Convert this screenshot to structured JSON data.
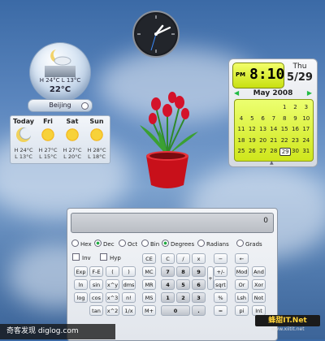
{
  "clock": {
    "time_shown": "1:23"
  },
  "weather": {
    "globe_line1": "H 24°C L 13°C",
    "globe_temp": "22°C",
    "city": "Beijing",
    "forecast": [
      {
        "day": "Today",
        "icon": "moon-cloud-icon",
        "high": "H 24°C",
        "low": "L 13°C"
      },
      {
        "day": "Fri",
        "icon": "sun-icon",
        "high": "H 27°C",
        "low": "L 15°C"
      },
      {
        "day": "Sat",
        "icon": "sun-icon",
        "high": "H 27°C",
        "low": "L 20°C"
      },
      {
        "day": "Sun",
        "icon": "sun-icon",
        "high": "H 28°C",
        "low": "L 18°C"
      }
    ]
  },
  "calendar": {
    "pm": "PM",
    "time": "8:10",
    "weekday": "Thu",
    "date": "5/29",
    "month_title": "May 2008",
    "weeks": [
      [
        "",
        "",
        "",
        "",
        "1",
        "2",
        "3"
      ],
      [
        "4",
        "5",
        "6",
        "7",
        "8",
        "9",
        "10"
      ],
      [
        "11",
        "12",
        "13",
        "14",
        "15",
        "16",
        "17"
      ],
      [
        "18",
        "19",
        "20",
        "21",
        "22",
        "23",
        "24"
      ],
      [
        "25",
        "26",
        "27",
        "28",
        "29",
        "30",
        "31"
      ]
    ],
    "today": "29"
  },
  "calculator": {
    "display": "0",
    "radix": [
      {
        "label": "Hex",
        "on": false
      },
      {
        "label": "Dec",
        "on": true
      },
      {
        "label": "Oct",
        "on": false
      },
      {
        "label": "Bin",
        "on": false
      }
    ],
    "angle": [
      {
        "label": "Degrees",
        "on": true
      },
      {
        "label": "Radians",
        "on": false
      },
      {
        "label": "Grads",
        "on": false
      }
    ],
    "checks": [
      "Inv",
      "Hyp"
    ],
    "rows": [
      [
        "CE",
        "C",
        "/",
        "x",
        "−",
        "←"
      ],
      [
        "Exp",
        "F-E",
        "(",
        ")",
        "MC",
        "7",
        "8",
        "9",
        "+/-",
        "Mod",
        "And"
      ],
      [
        "ln",
        "sin",
        "x^y",
        "dms",
        "MR",
        "4",
        "5",
        "6",
        "sqrt",
        "Or",
        "Xor"
      ],
      [
        "log",
        "cos",
        "x^3",
        "n!",
        "MS",
        "1",
        "2",
        "3",
        "%",
        "Lsh",
        "Not"
      ],
      [
        "tan",
        "x^2",
        "1/x",
        "M+",
        "0",
        ".",
        "=",
        "pi",
        "Int"
      ]
    ],
    "plus": "+"
  },
  "watermark": {
    "left": "奇客发现 diglog.com",
    "right_top": "蜂甜IT.Net",
    "right_bottom": "www.xiitit.net"
  }
}
